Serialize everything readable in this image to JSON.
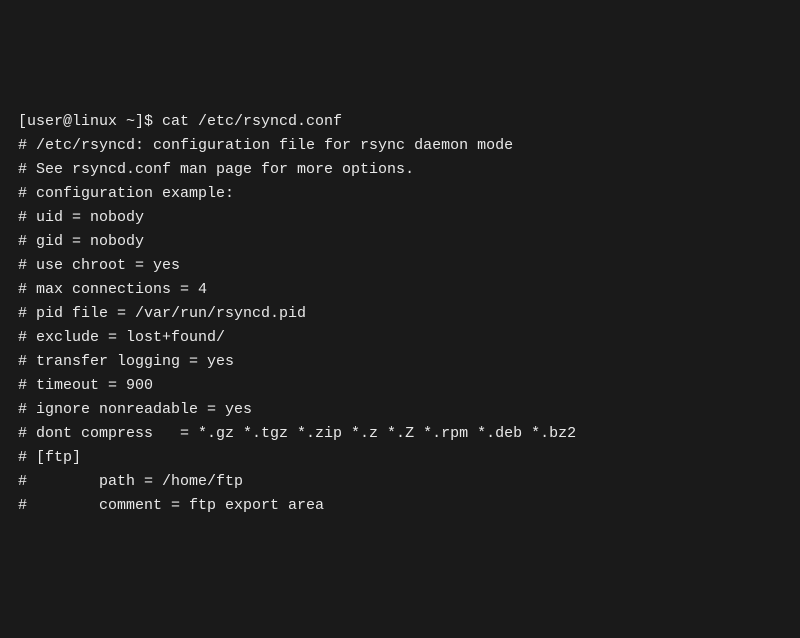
{
  "terminal": {
    "prompt": "[user@linux ~]$ ",
    "command": "cat /etc/rsyncd.conf",
    "output_lines": [
      "# /etc/rsyncd: configuration file for rsync daemon mode",
      "",
      "# See rsyncd.conf man page for more options.",
      "",
      "# configuration example:",
      "",
      "# uid = nobody",
      "# gid = nobody",
      "# use chroot = yes",
      "# max connections = 4",
      "# pid file = /var/run/rsyncd.pid",
      "# exclude = lost+found/",
      "# transfer logging = yes",
      "# timeout = 900",
      "# ignore nonreadable = yes",
      "# dont compress   = *.gz *.tgz *.zip *.z *.Z *.rpm *.deb *.bz2",
      "",
      "# [ftp]",
      "#        path = /home/ftp",
      "#        comment = ftp export area"
    ]
  }
}
